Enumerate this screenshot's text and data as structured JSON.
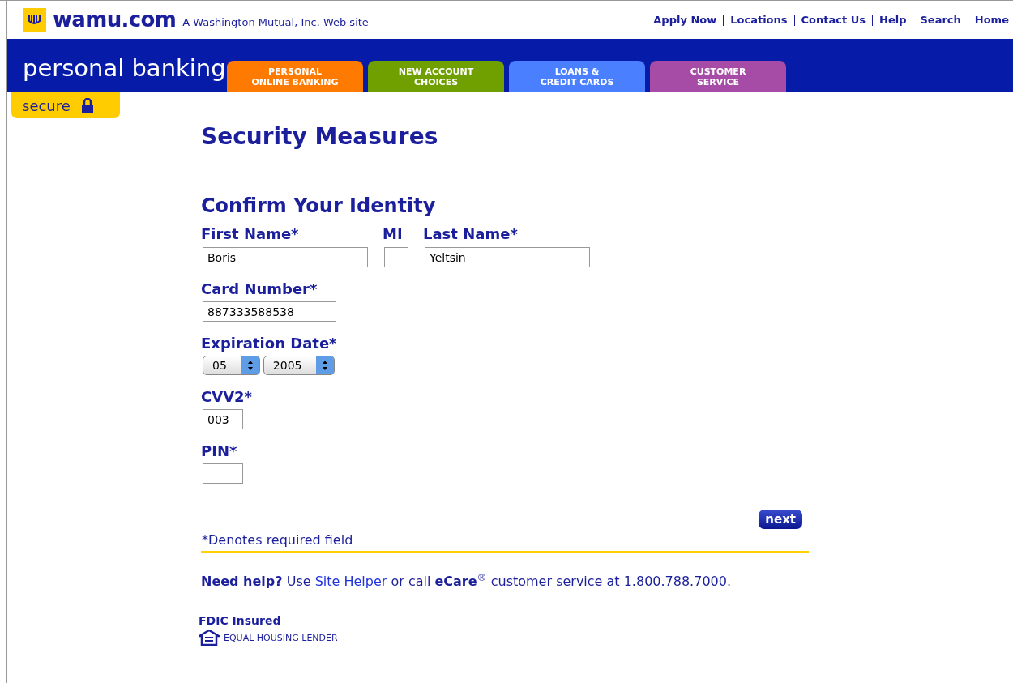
{
  "header": {
    "logo": "wamu.com",
    "tagline": "A Washington Mutual, Inc. Web site",
    "links": [
      "Apply Now",
      "Locations",
      "Contact Us",
      "Help",
      "Search",
      "Home"
    ]
  },
  "banner": {
    "title": "personal banking",
    "badge": "secure"
  },
  "tabs": [
    {
      "lines": [
        "PERSONAL",
        "ONLINE BANKING"
      ],
      "color": "#ff7a00"
    },
    {
      "lines": [
        "NEW ACCOUNT",
        "CHOICES"
      ],
      "color": "#6fa000"
    },
    {
      "lines": [
        "LOANS &",
        "CREDIT CARDS"
      ],
      "color": "#4a80ff"
    },
    {
      "lines": [
        "CUSTOMER",
        "SERVICE"
      ],
      "color": "#a64ca6"
    }
  ],
  "page_title": "Security Measures",
  "section_title": "Confirm Your Identity",
  "name_row": [
    {
      "label": "First Name*",
      "value": "Boris"
    },
    {
      "label": "MI"
    },
    {
      "label": "Last Name*",
      "value": "Yeltsin"
    }
  ],
  "fields": [
    {
      "kind": "text",
      "label": "Card Number*",
      "value": "887333588538"
    },
    {
      "kind": "selects",
      "label": "Expiration Date*",
      "selects": [
        "05",
        "2005"
      ]
    },
    {
      "kind": "text",
      "label": "CVV2*",
      "value": "003"
    },
    {
      "kind": "text",
      "label": "PIN*"
    }
  ],
  "next_button": "next",
  "required_note": "*Denotes required field",
  "help": {
    "before": "**Need help?** Use ",
    "link": "Site Helper",
    "after": " or call **eCare**$^{®}$ customer service at 1.800.788.7000."
  },
  "footer": {
    "fdic": "FDIC Insured",
    "lender": "EQUAL HOUSING LENDER"
  }
}
